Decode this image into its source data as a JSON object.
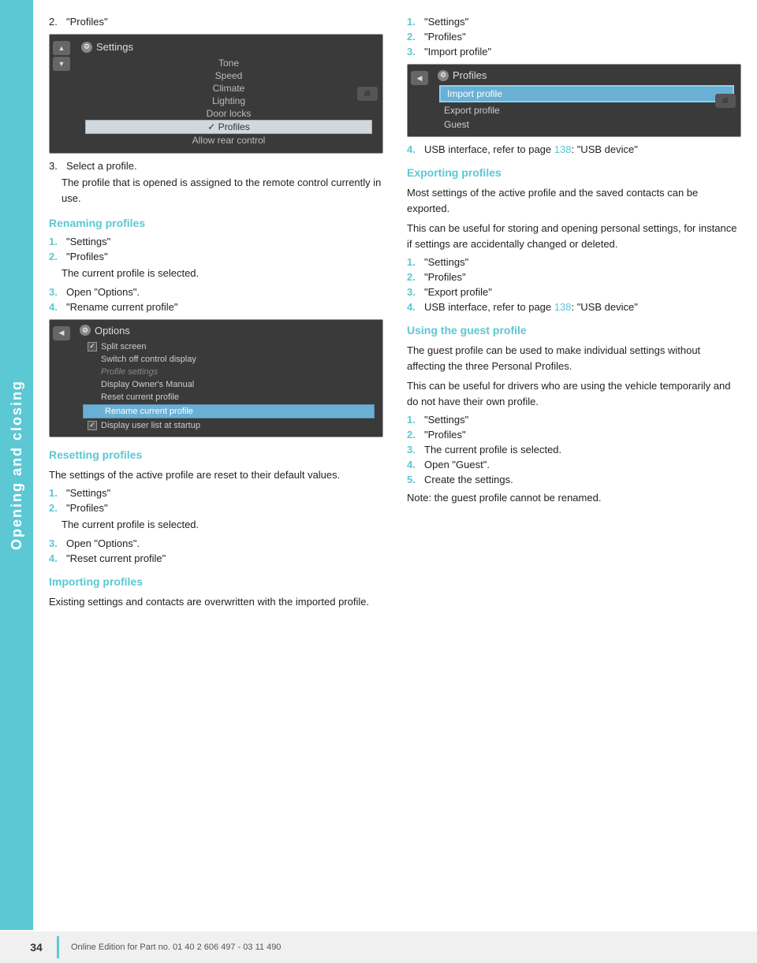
{
  "sidebar": {
    "label": "Opening and closing"
  },
  "page_number": "34",
  "footer_text": "Online Edition for Part no. 01 40 2 606 497 - 03 11 490",
  "left_col": {
    "step2_label": "\"Profiles\"",
    "step3_label": "Select a profile.",
    "step3_body": "The profile that is opened is assigned to the remote control currently in use.",
    "renaming_heading": "Renaming profiles",
    "renaming_step1": "\"Settings\"",
    "renaming_step2": "\"Profiles\"",
    "renaming_step2_note": "The current profile is selected.",
    "renaming_step3": "Open \"Options\".",
    "renaming_step4": "\"Rename current profile\"",
    "resetting_heading": "Resetting profiles",
    "resetting_body": "The settings of the active profile are reset to their default values.",
    "resetting_step1": "\"Settings\"",
    "resetting_step2": "\"Profiles\"",
    "resetting_step2_note": "The current profile is selected.",
    "resetting_step3": "Open \"Options\".",
    "resetting_step4": "\"Reset current profile\"",
    "importing_heading": "Importing profiles",
    "importing_body": "Existing settings and contacts are overwritten with the imported profile.",
    "settings_screenshot": {
      "title": "Settings",
      "items": [
        "Tone",
        "Speed",
        "Climate",
        "Lighting",
        "Door locks",
        "Profiles",
        "Allow rear control"
      ],
      "selected_item": "Profiles",
      "check_item": "Profiles"
    },
    "options_screenshot": {
      "title": "Options",
      "items": [
        {
          "label": "Split screen",
          "type": "checkbox",
          "checked": true
        },
        {
          "label": "Switch off control display",
          "type": "plain"
        },
        {
          "label": "Profile settings",
          "type": "grayed"
        },
        {
          "label": "Display Owner's Manual",
          "type": "plain"
        },
        {
          "label": "Reset current profile",
          "type": "plain"
        },
        {
          "label": "Rename current profile",
          "type": "highlighted"
        },
        {
          "label": "Display user list at startup",
          "type": "checkbox",
          "checked": true
        }
      ]
    }
  },
  "right_col": {
    "importing_step1": "\"Settings\"",
    "importing_step2": "\"Profiles\"",
    "importing_step3": "\"Import profile\"",
    "importing_step4_pre": "USB interface, refer to page ",
    "importing_step4_page": "138",
    "importing_step4_post": ": \"USB device\"",
    "exporting_heading": "Exporting profiles",
    "exporting_body1": "Most settings of the active profile and the saved contacts can be exported.",
    "exporting_body2": "This can be useful for storing and opening personal settings, for instance if settings are accidentally changed or deleted.",
    "exporting_step1": "\"Settings\"",
    "exporting_step2": "\"Profiles\"",
    "exporting_step3": "\"Export profile\"",
    "exporting_step4_pre": "USB interface, refer to page ",
    "exporting_step4_page": "138",
    "exporting_step4_post": ": \"USB device\"",
    "guest_heading": "Using the guest profile",
    "guest_body1": "The guest profile can be used to make individual settings without affecting the three Personal Profiles.",
    "guest_body2": "This can be useful for drivers who are using the vehicle temporarily and do not have their own profile.",
    "guest_step1": "\"Settings\"",
    "guest_step2": "\"Profiles\"",
    "guest_step3": "The current profile is selected.",
    "guest_step4": "Open \"Guest\".",
    "guest_step5": "Create the settings.",
    "guest_note": "Note: the guest profile cannot be renamed.",
    "profiles_screenshot": {
      "title": "Profiles",
      "items": [
        "Import profile",
        "Export profile",
        "Guest"
      ],
      "selected_item": "Import profile"
    }
  }
}
